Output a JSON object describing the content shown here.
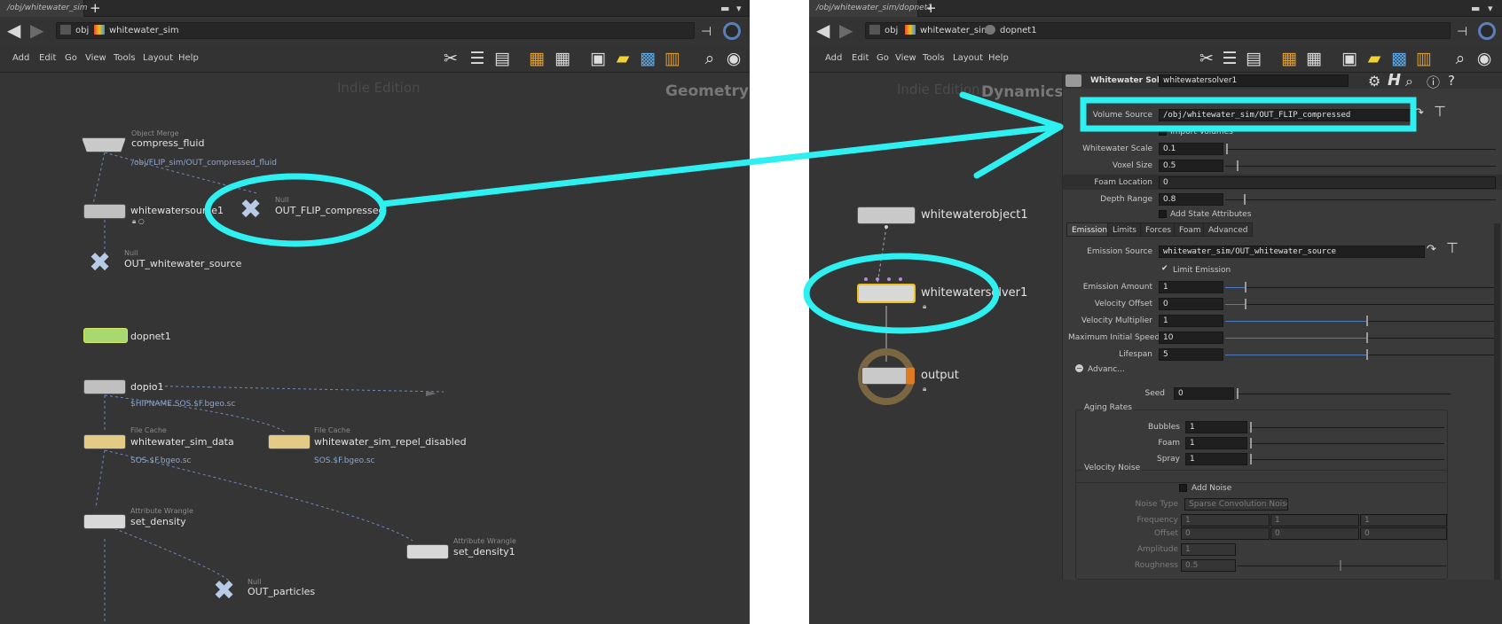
{
  "left": {
    "tab": "/obj/whitewater_sim",
    "path": [
      "obj",
      "whitewater_sim"
    ],
    "menu": [
      "Add",
      "Edit",
      "Go",
      "View",
      "Tools",
      "Layout",
      "Help"
    ],
    "watermark": "Indie Edition",
    "context": "Geometry",
    "nodes": {
      "compress": {
        "type": "Object Merge",
        "name": "compress_fluid",
        "sub": "/obj/FLIP_sim/OUT_compressed_fluid"
      },
      "source": {
        "name": "whitewatersource1"
      },
      "outflip": {
        "type": "Null",
        "name": "OUT_FLIP_compressed"
      },
      "outsrc": {
        "type": "Null",
        "name": "OUT_whitewater_source"
      },
      "dopnet": {
        "name": "dopnet1"
      },
      "dopio": {
        "name": "dopio1",
        "sub": "$HIPNAME.SOS.$F.bgeo.sc"
      },
      "cache1": {
        "type": "File Cache",
        "name": "whitewater_sim_data",
        "sub": "SOS.$F.bgeo.sc"
      },
      "cache2": {
        "type": "File Cache",
        "name": "whitewater_sim_repel_disabled",
        "sub": "SOS.$F.bgeo.sc"
      },
      "wrangle1": {
        "type": "Attribute Wrangle",
        "name": "set_density"
      },
      "wrangle2": {
        "type": "Attribute Wrangle",
        "name": "set_density1"
      },
      "outparts": {
        "type": "Null",
        "name": "OUT_particles"
      }
    }
  },
  "right": {
    "tab": "/obj/whitewater_sim/dopnet1",
    "path": [
      "obj",
      "whitewater_sim",
      "dopnet1"
    ],
    "menu": [
      "Add",
      "Edit",
      "Go",
      "View",
      "Tools",
      "Layout",
      "Help"
    ],
    "watermark": "Indie Edition",
    "context": "Dynamics",
    "nodes": {
      "object": "whitewaterobject1",
      "solver": "whitewatersolver1",
      "output": "output"
    },
    "params": {
      "header_type": "Whitewater Solver",
      "header_name": "whitewatersolver1",
      "volume_source_label": "Volume Source",
      "volume_source": "/obj/whitewater_sim/OUT_FLIP_compressed",
      "import_volumes": "Import Volumes",
      "ww_scale_label": "Whitewater Scale",
      "ww_scale": "0.1",
      "voxel_label": "Voxel Size",
      "voxel": "0.5",
      "foam_loc_label": "Foam Location",
      "foam_loc": "0",
      "depth_label": "Depth Range",
      "depth": "0.8",
      "state_attrs": "Add State Attributes",
      "tabs": [
        "Emission",
        "Limits",
        "Forces",
        "Foam",
        "Advanced"
      ],
      "emission_source_label": "Emission Source",
      "emission_source": "whitewater_sim/OUT_whitewater_source",
      "limit_emission": "Limit Emission",
      "rows": [
        {
          "label": "Emission Amount",
          "value": "1"
        },
        {
          "label": "Velocity Offset",
          "value": "0"
        },
        {
          "label": "Velocity Multiplier",
          "value": "1"
        },
        {
          "label": "Maximum Initial Speed",
          "value": "10"
        },
        {
          "label": "Lifespan",
          "value": "5"
        }
      ],
      "advanced": "Advanc...",
      "seed_label": "Seed",
      "seed": "0",
      "aging": "Aging Rates",
      "aging_rows": [
        {
          "label": "Bubbles",
          "value": "1"
        },
        {
          "label": "Foam",
          "value": "1"
        },
        {
          "label": "Spray",
          "value": "1"
        }
      ],
      "velocity_noise": "Velocity Noise",
      "add_noise": "Add Noise",
      "noise_type_label": "Noise Type",
      "noise_type": "Sparse Convolution Noise",
      "frequency_label": "Frequency",
      "freq": [
        "1",
        "1",
        "1"
      ],
      "offset_label": "Offset",
      "off": [
        "0",
        "0",
        "0"
      ],
      "amplitude_label": "Amplitude",
      "amp": "1",
      "roughness_label": "Roughness",
      "rough": "0.5"
    }
  },
  "colors": {
    "highlight": "#2ef0f0",
    "pane": "#353535",
    "param_bg": "#3a3a3a",
    "field": "#1f1f1f",
    "accent": "#4d7bbd",
    "cache": "#e3cb86",
    "dopnet": "#a8d870",
    "wrangle": "#d8d8d8"
  }
}
